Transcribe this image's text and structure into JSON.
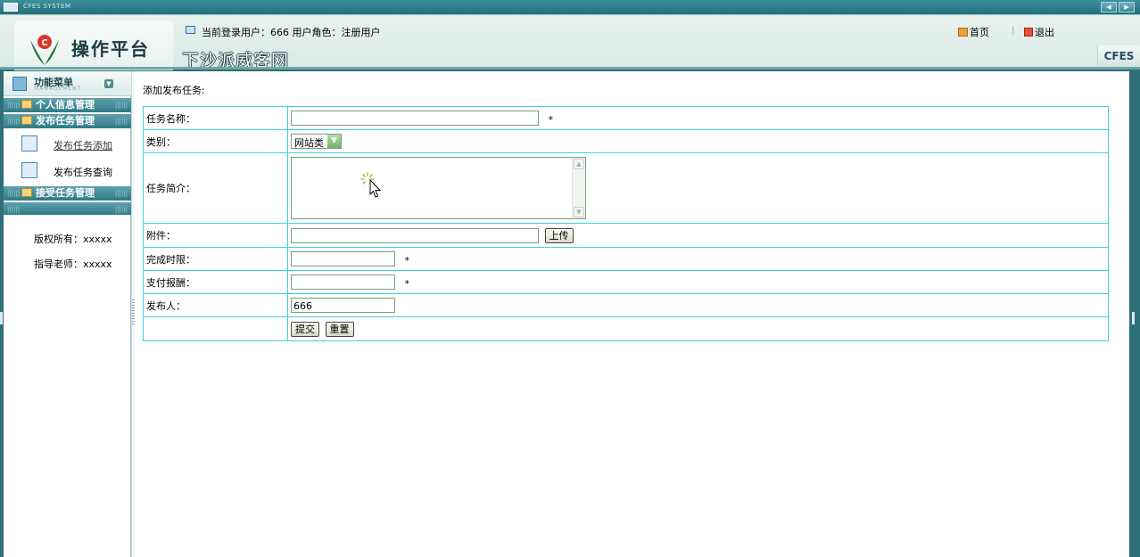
{
  "window": {
    "system_title": "CFES SYSTEM"
  },
  "header": {
    "platform_name": "操作平台",
    "site_name": "下沙派威客网",
    "user_info": "当前登录用户：666   用户角色：注册用户",
    "home_label": "首页",
    "separator": "|",
    "logout_label": "退出",
    "brand": "CFES"
  },
  "sidebar": {
    "menu_title": "功能菜单",
    "menu_subtitle": "MANAGEMENT",
    "groups": [
      {
        "label": "个人信息管理"
      },
      {
        "label": "发布任务管理"
      },
      {
        "label": "接受任务管理"
      }
    ],
    "items": [
      {
        "label": "发布任务添加"
      },
      {
        "label": "发布任务查询"
      }
    ],
    "copyright": "版权所有：xxxxx",
    "advisor": "指导老师：xxxxx"
  },
  "main": {
    "heading": "添加发布任务:",
    "form": {
      "task_name_label": "任务名称：",
      "task_name_value": "",
      "required_mark": "*",
      "category_label": "类别：",
      "category_value": "网站类",
      "description_label": "任务简介：",
      "description_value": "",
      "attachment_label": "附件：",
      "attachment_value": "",
      "upload_button": "上传",
      "deadline_label": "完成时限：",
      "deadline_value": "",
      "payment_label": "支付报酬：",
      "payment_value": "",
      "publisher_label": "发布人：",
      "publisher_value": "666",
      "submit_button": "提交",
      "reset_button": "重置"
    }
  },
  "colors": {
    "frame": "#2e6f78",
    "table_border": "#3fd0e0",
    "group_bar": "#2e7a87"
  }
}
